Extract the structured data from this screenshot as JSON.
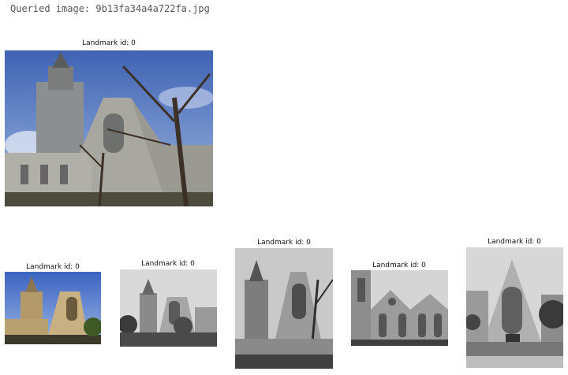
{
  "query": {
    "label": "Queried image: 9b13fa34a4a722fa.jpg",
    "image_caption": "Landmark id: 0"
  },
  "results": [
    {
      "caption": "Landmark id: 0"
    },
    {
      "caption": "Landmark id: 0"
    },
    {
      "caption": "Landmark id: 0"
    },
    {
      "caption": "Landmark id: 0"
    },
    {
      "caption": "Landmark id: 0"
    }
  ],
  "colors": {
    "sky_blue": "#5f82c4",
    "stone": "#a7a69f",
    "foliage": "#3e4a2a"
  }
}
